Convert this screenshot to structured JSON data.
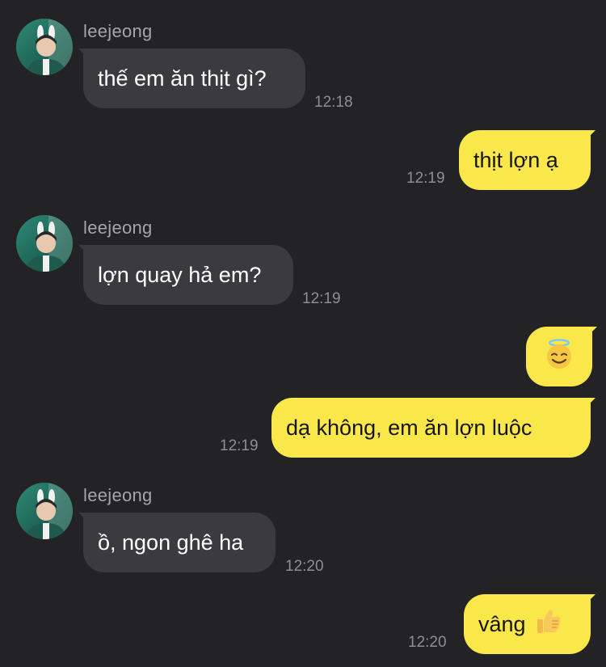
{
  "messages": [
    {
      "id": "m1",
      "direction": "incoming",
      "sender": "leejeong",
      "text": "thế em ăn thịt gì?",
      "time": "12:18"
    },
    {
      "id": "m2",
      "direction": "outgoing",
      "text": "thịt lợn ạ",
      "time": "12:19"
    },
    {
      "id": "m3",
      "direction": "incoming",
      "sender": "leejeong",
      "text": "lợn quay hả em?",
      "time": "12:19"
    },
    {
      "id": "m4",
      "direction": "outgoing",
      "emoji": "smiling-face-with-halo",
      "text": "😇"
    },
    {
      "id": "m5",
      "direction": "outgoing",
      "text": "dạ không, em ăn lợn luộc",
      "time": "12:19"
    },
    {
      "id": "m6",
      "direction": "incoming",
      "sender": "leejeong",
      "text": "ồ, ngon ghê ha",
      "time": "12:20"
    },
    {
      "id": "m7",
      "direction": "outgoing",
      "text": "vâng",
      "emoji": "thumbs-up",
      "time": "12:20"
    }
  ],
  "colors": {
    "background": "#232326",
    "incoming_bubble": "#3b3b3f",
    "outgoing_bubble": "#fae84a",
    "sender_name": "#a5a5aa",
    "timestamp": "#8e8e93"
  }
}
